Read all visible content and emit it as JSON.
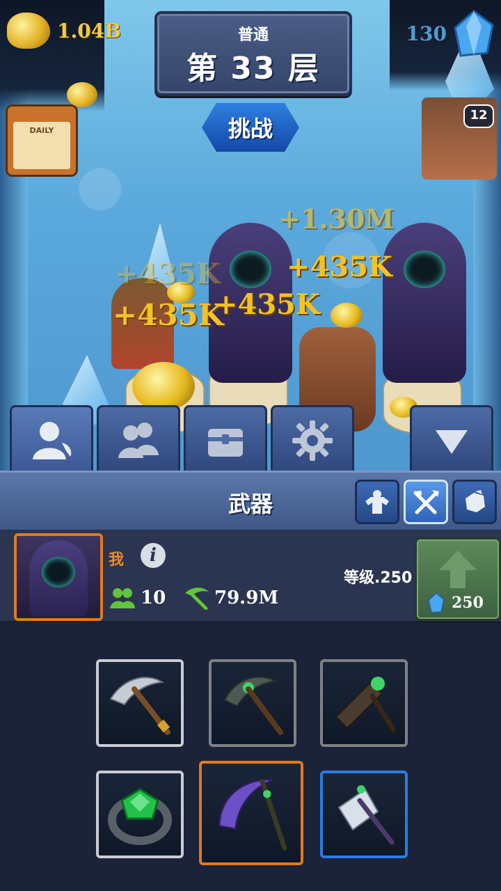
{
  "hud": {
    "gold": "1.04B",
    "gems": "130",
    "level_mode": "普通",
    "level_label": "第 33 层",
    "challenge_label": "挑战",
    "daily_label": "DAILY",
    "robot_badge": "12"
  },
  "floating_numbers": [
    "+1.30M",
    "+435K",
    "+435K",
    "+435K",
    "+435K"
  ],
  "tabs": [
    {
      "name": "character",
      "icon": "person-icon"
    },
    {
      "name": "team",
      "icon": "group-icon"
    },
    {
      "name": "chest",
      "icon": "chest-icon"
    },
    {
      "name": "settings",
      "icon": "gear-icon"
    },
    {
      "name": "collapse",
      "icon": "triangle-down-icon"
    }
  ],
  "section": {
    "title": "武器",
    "categories": [
      {
        "name": "strength",
        "icon": "muscle-icon"
      },
      {
        "name": "weapons",
        "icon": "crossed-tools-icon",
        "active": true
      },
      {
        "name": "ore",
        "icon": "rock-icon"
      }
    ]
  },
  "character": {
    "name": "我",
    "team_count": "10",
    "mining_power": "79.9M",
    "level_text": "等级.250",
    "upgrade_cost": "250"
  },
  "weapons": [
    {
      "name": "iron-pickaxe",
      "rarity": "silver"
    },
    {
      "name": "jade-pickaxe",
      "rarity": "gray"
    },
    {
      "name": "emerald-hammer",
      "rarity": "gray"
    },
    {
      "name": "emerald-ring",
      "rarity": "silver"
    },
    {
      "name": "void-scythe",
      "rarity": "orange",
      "equipped": true
    },
    {
      "name": "crystal-axe",
      "rarity": "blue"
    }
  ],
  "colors": {
    "gold": "#f2c94c",
    "gem": "#5fb1e8",
    "orange": "#e07a20",
    "blue": "#2a7ce0",
    "panel": "#2b3450"
  }
}
